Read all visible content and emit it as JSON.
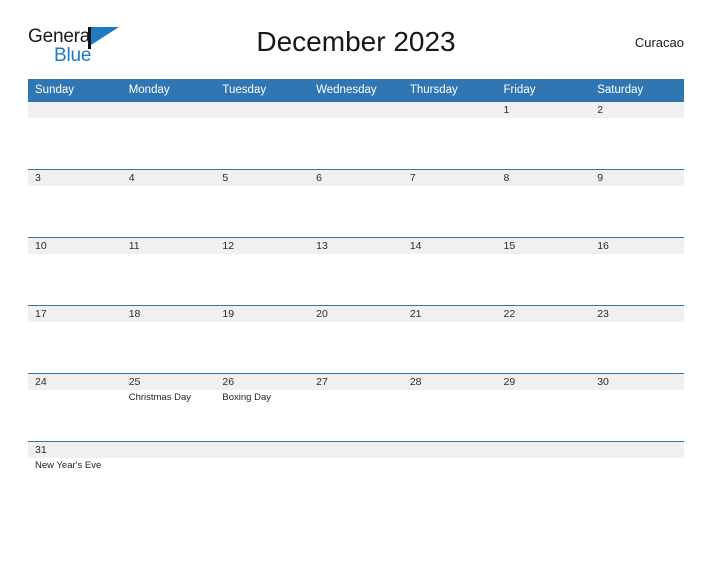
{
  "brand": {
    "name_part1": "General",
    "name_part2": "Blue",
    "flag_icon": "general-blue-flag-icon",
    "accent_color": "#1f7ac4"
  },
  "header": {
    "title": "December 2023",
    "locale": "Curacao"
  },
  "theme": {
    "header_blue": "#3076B3",
    "daynum_band": "#f0f0f0",
    "text_dark": "#1a1a1a"
  },
  "calendar": {
    "weekday_headers": [
      "Sunday",
      "Monday",
      "Tuesday",
      "Wednesday",
      "Thursday",
      "Friday",
      "Saturday"
    ],
    "weeks": [
      {
        "days": [
          {
            "num": "",
            "events": []
          },
          {
            "num": "",
            "events": []
          },
          {
            "num": "",
            "events": []
          },
          {
            "num": "",
            "events": []
          },
          {
            "num": "",
            "events": []
          },
          {
            "num": "1",
            "events": []
          },
          {
            "num": "2",
            "events": []
          }
        ]
      },
      {
        "days": [
          {
            "num": "3",
            "events": []
          },
          {
            "num": "4",
            "events": []
          },
          {
            "num": "5",
            "events": []
          },
          {
            "num": "6",
            "events": []
          },
          {
            "num": "7",
            "events": []
          },
          {
            "num": "8",
            "events": []
          },
          {
            "num": "9",
            "events": []
          }
        ]
      },
      {
        "days": [
          {
            "num": "10",
            "events": []
          },
          {
            "num": "11",
            "events": []
          },
          {
            "num": "12",
            "events": []
          },
          {
            "num": "13",
            "events": []
          },
          {
            "num": "14",
            "events": []
          },
          {
            "num": "15",
            "events": []
          },
          {
            "num": "16",
            "events": []
          }
        ]
      },
      {
        "days": [
          {
            "num": "17",
            "events": []
          },
          {
            "num": "18",
            "events": []
          },
          {
            "num": "19",
            "events": []
          },
          {
            "num": "20",
            "events": []
          },
          {
            "num": "21",
            "events": []
          },
          {
            "num": "22",
            "events": []
          },
          {
            "num": "23",
            "events": []
          }
        ]
      },
      {
        "days": [
          {
            "num": "24",
            "events": []
          },
          {
            "num": "25",
            "events": [
              "Christmas Day"
            ]
          },
          {
            "num": "26",
            "events": [
              "Boxing Day"
            ]
          },
          {
            "num": "27",
            "events": []
          },
          {
            "num": "28",
            "events": []
          },
          {
            "num": "29",
            "events": []
          },
          {
            "num": "30",
            "events": []
          }
        ]
      },
      {
        "days": [
          {
            "num": "31",
            "events": [
              "New Year's Eve"
            ]
          },
          {
            "num": "",
            "events": []
          },
          {
            "num": "",
            "events": []
          },
          {
            "num": "",
            "events": []
          },
          {
            "num": "",
            "events": []
          },
          {
            "num": "",
            "events": []
          },
          {
            "num": "",
            "events": []
          }
        ]
      }
    ]
  }
}
